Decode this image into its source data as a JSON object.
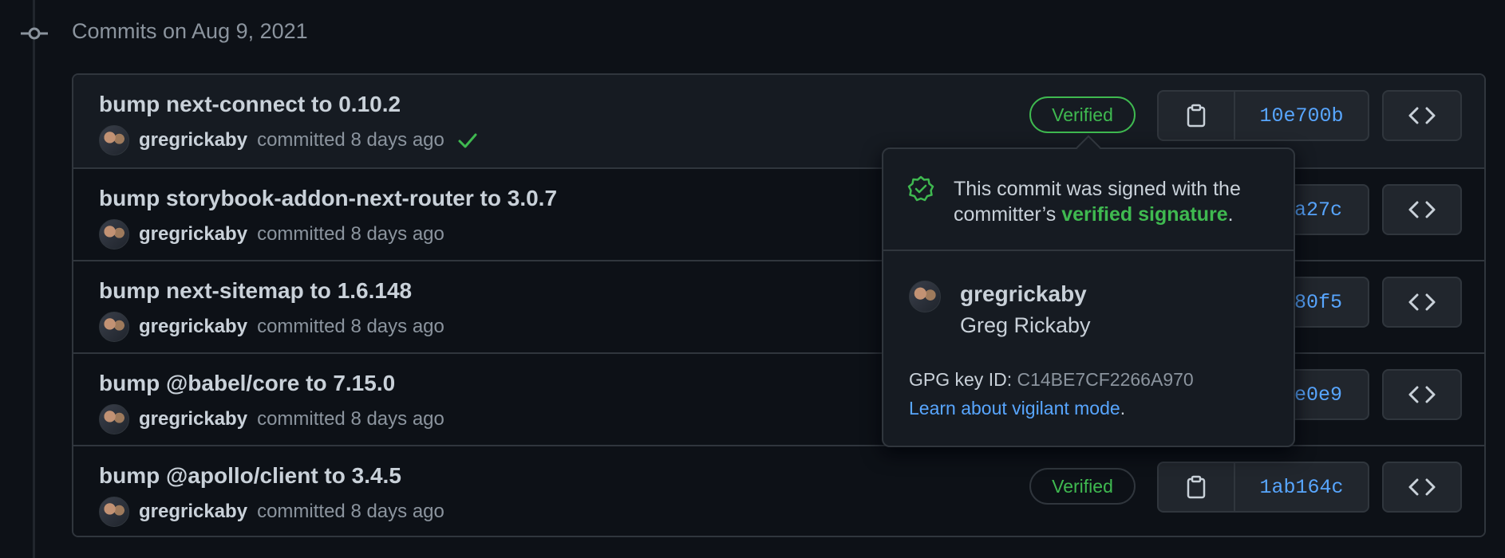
{
  "timeline": {
    "date_heading": "Commits on Aug 9, 2021"
  },
  "commits": [
    {
      "title": "bump next-connect to 0.10.2",
      "author": "gregrickaby",
      "meta": "committed 8 days ago",
      "sha": "10e700b",
      "badge": "Verified",
      "status": "success"
    },
    {
      "title": "bump storybook-addon-next-router to 3.0.7",
      "author": "gregrickaby",
      "meta": "committed 8 days ago",
      "sha": "a27c"
    },
    {
      "title": "bump next-sitemap to 1.6.148",
      "author": "gregrickaby",
      "meta": "committed 8 days ago",
      "sha": "80f5"
    },
    {
      "title": "bump @babel/core to 7.15.0",
      "author": "gregrickaby",
      "meta": "committed 8 days ago",
      "sha": "e0e9"
    },
    {
      "title": "bump @apollo/client to 3.4.5",
      "author": "gregrickaby",
      "meta": "committed 8 days ago",
      "sha": "1ab164c",
      "badge": "Verified"
    }
  ],
  "popover": {
    "message_prefix": "This commit was signed with the committer’s ",
    "message_link": "verified signature",
    "message_suffix": ".",
    "login": "gregrickaby",
    "name": "Greg Rickaby",
    "gpg_label": "GPG key ID: ",
    "gpg_key": "C14BE7CF2266A970",
    "learn_link": "Learn about vigilant mode",
    "learn_suffix": "."
  },
  "icons": {
    "timeline": "git-commit-icon",
    "status": "check-icon",
    "copy": "clipboard-icon",
    "browse": "code-icon",
    "signature": "verified-shield-icon"
  },
  "colors": {
    "background": "#0d1117",
    "border": "#30363d",
    "verified": "#3fb950",
    "link": "#58a6ff",
    "muted_text": "#8b949e"
  }
}
